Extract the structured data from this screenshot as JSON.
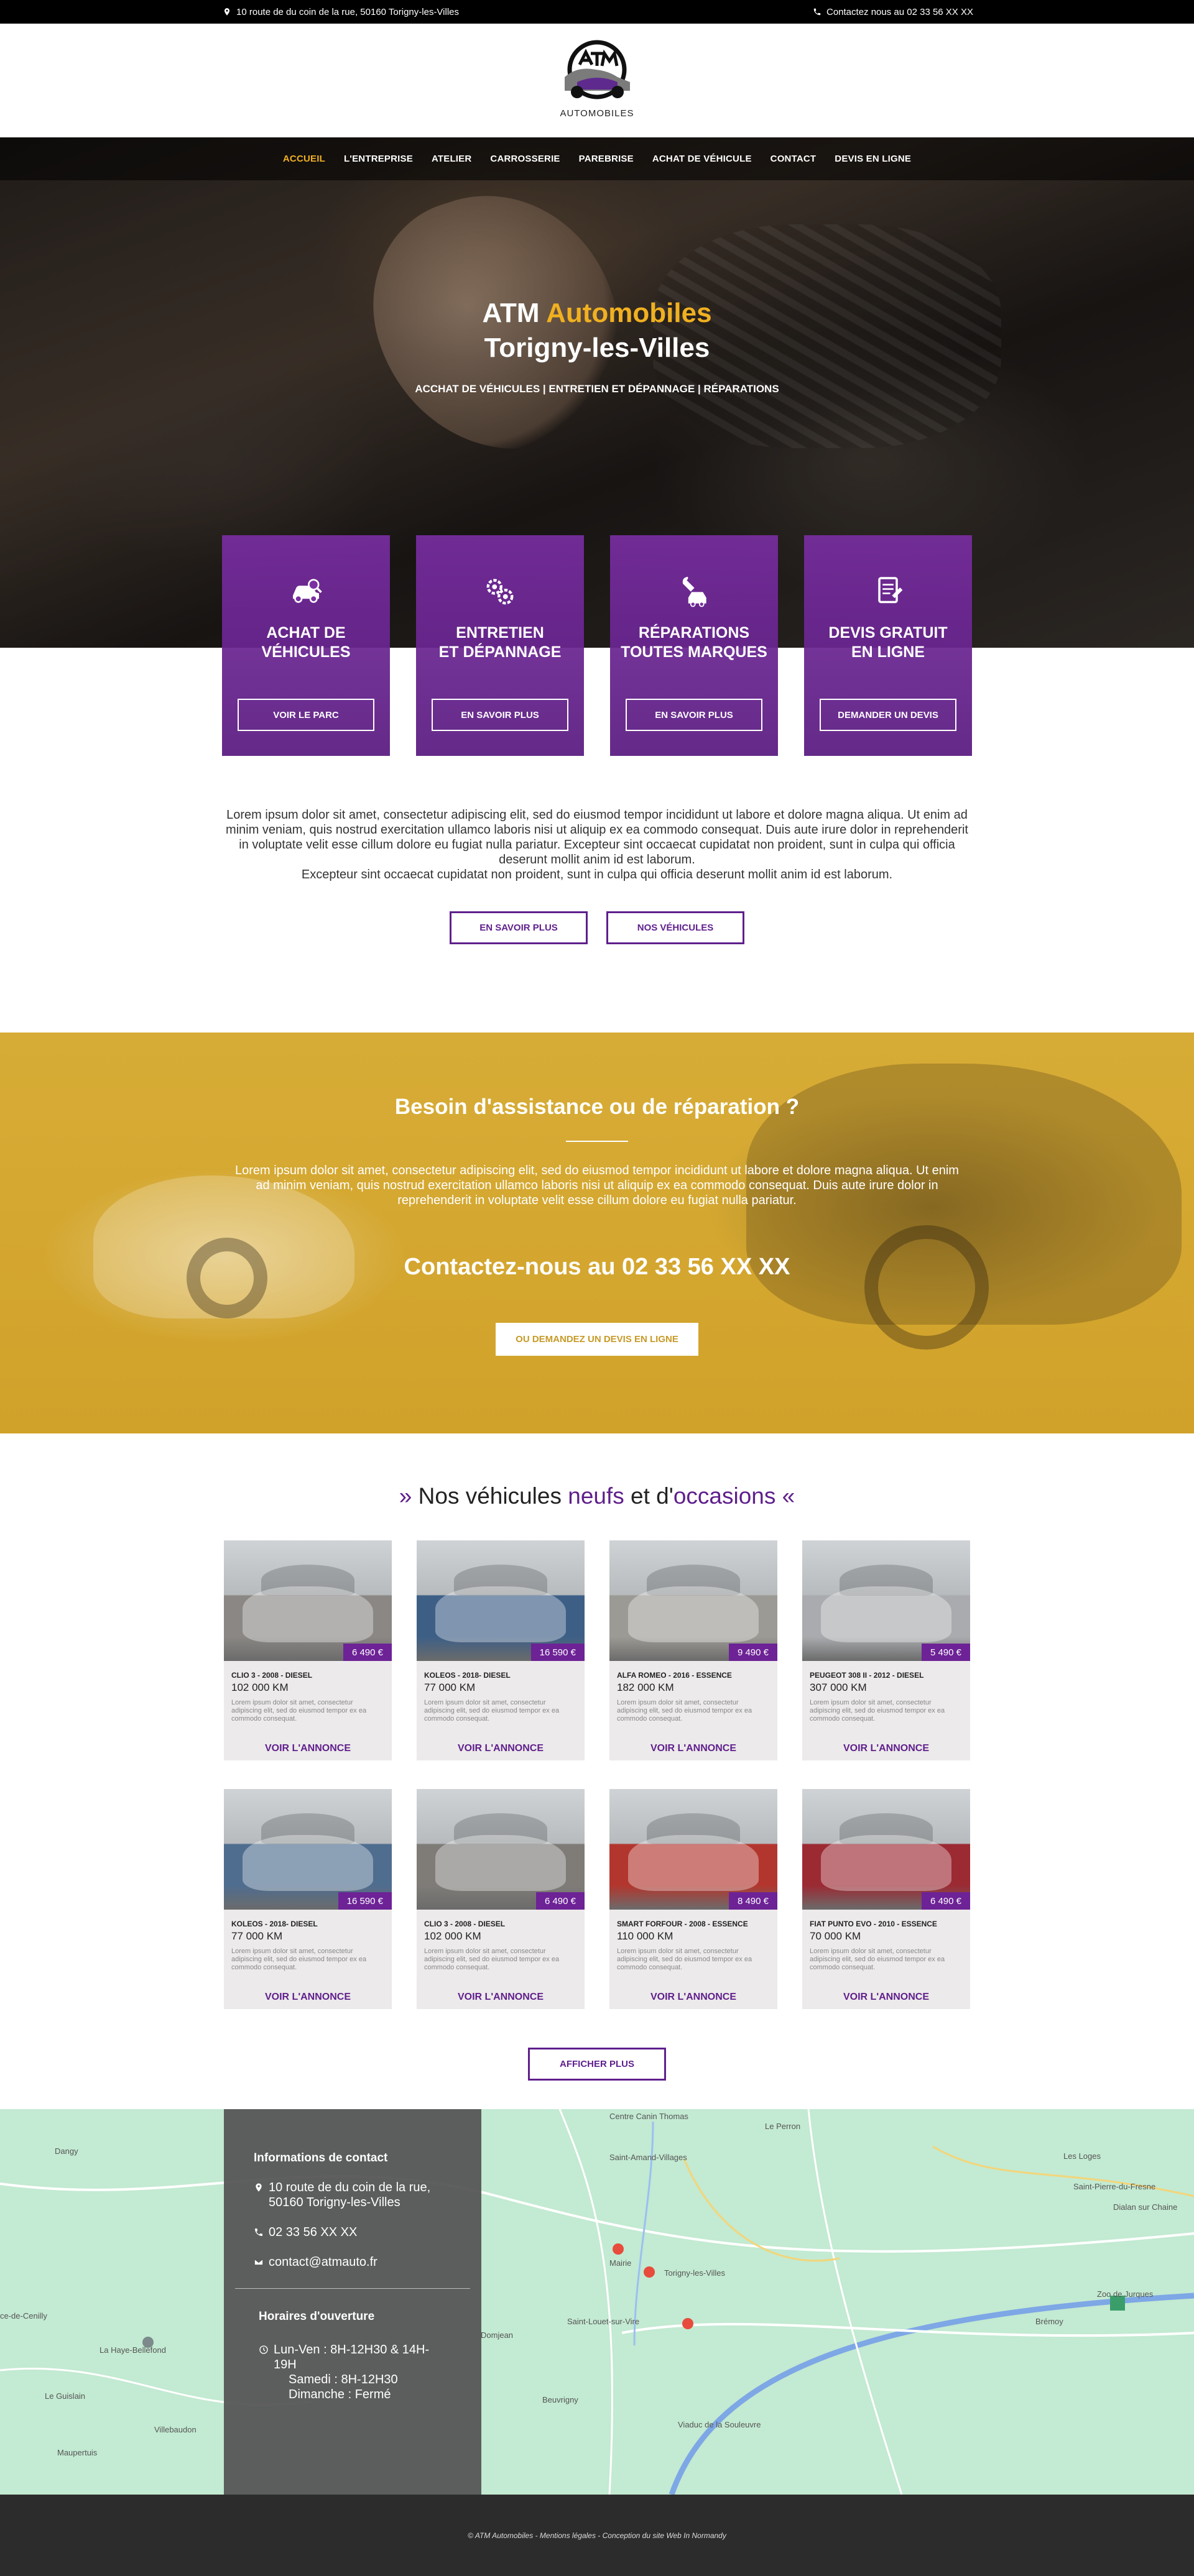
{
  "topbar": {
    "address": "10 route de du coin de la rue, 50160 Torigny-les-Villes",
    "phone": "Contactez nous au 02 33 56 XX XX"
  },
  "logo": {
    "text": "AUTOMOBILES"
  },
  "nav": [
    {
      "label": "ACCUEIL",
      "active": true
    },
    {
      "label": "L'ENTREPRISE"
    },
    {
      "label": "ATELIER"
    },
    {
      "label": "CARROSSERIE"
    },
    {
      "label": "PAREBRISE"
    },
    {
      "label": "ACHAT DE VÉHICULE"
    },
    {
      "label": "CONTACT"
    },
    {
      "label": "DEVIS EN LIGNE"
    }
  ],
  "hero": {
    "title_part1": "ATM ",
    "title_accent": "Automobiles",
    "title_line2": "Torigny-les-Villes",
    "subtitle": "ACCHAT DE VÉHICULES | ENTRETIEN ET DÉPANNAGE | RÉPARATIONS"
  },
  "services": [
    {
      "icon": "car-search-icon",
      "title": "ACHAT DE\nVÉHICULES",
      "button": "VOIR LE PARC"
    },
    {
      "icon": "gears-icon",
      "title": "ENTRETIEN\nET DÉPANNAGE",
      "button": "EN SAVOIR PLUS"
    },
    {
      "icon": "wrench-car-icon",
      "title": "RÉPARATIONS\nTOUTES MARQUES",
      "button": "EN SAVOIR PLUS"
    },
    {
      "icon": "quote-document-icon",
      "title": "DEVIS GRATUIT\nEN LIGNE",
      "button": "DEMANDER UN DEVIS"
    }
  ],
  "intro": {
    "text": "Lorem ipsum dolor sit amet, consectetur adipiscing elit, sed do eiusmod tempor incididunt ut labore et dolore magna aliqua. Ut enim ad minim veniam, quis nostrud exercitation ullamco laboris nisi ut aliquip ex ea commodo consequat. Duis aute irure dolor in reprehenderit in voluptate velit esse cillum dolore eu fugiat nulla pariatur. Excepteur sint occaecat cupidatat non proident, sunt in culpa qui officia deserunt mollit anim id est laborum.",
    "text2": "Excepteur sint occaecat cupidatat non proident, sunt in culpa qui officia deserunt mollit anim id est laborum.",
    "btn1": "EN SAVOIR PLUS",
    "btn2": "NOS VÉHICULES"
  },
  "assist": {
    "title": "Besoin d'assistance ou de réparation ?",
    "text": "Lorem ipsum dolor sit amet, consectetur adipiscing elit, sed do eiusmod tempor incididunt ut labore et dolore magna aliqua. Ut enim ad minim veniam, quis nostrud exercitation ullamco laboris nisi ut aliquip ex ea commodo consequat. Duis aute irure dolor in reprehenderit in voluptate velit esse cillum dolore eu fugiat nulla pariatur.",
    "phone": "Contactez-nous au 02 33 56 XX XX",
    "button": "OU DEMANDEZ UN DEVIS EN LIGNE"
  },
  "vehicles": {
    "heading_prefix": "Nos véhicules ",
    "heading_neufs": "neufs",
    "heading_mid": " et d'",
    "heading_occ": "occasions",
    "quote_open": "»",
    "quote_close": "«",
    "desc": "Lorem ipsum dolor sit amet, consectetur adipiscing elit, sed do eiusmod tempor ex ea commodo consequat.",
    "link": "VOIR L'ANNONCE",
    "more": "AFFICHER PLUS",
    "items": [
      {
        "title": "CLIO 3 - 2008 - DIESEL",
        "km": "102 000 KM",
        "price": "6 490 €",
        "color": "#8a8784"
      },
      {
        "title": "KOLEOS - 2018- DIESEL",
        "km": "77 000 KM",
        "price": "16 590 €",
        "color": "#3d5f86"
      },
      {
        "title": "ALFA ROMEO - 2016 - ESSENCE",
        "km": "182 000 KM",
        "price": "9 490 €",
        "color": "#9c9a94"
      },
      {
        "title": "PEUGEOT 308 II - 2012 - DIESEL",
        "km": "307 000 KM",
        "price": "5 490 €",
        "color": "#a9abae"
      },
      {
        "title": "KOLEOS - 2018- DIESEL",
        "km": "77 000 KM",
        "price": "16 590 €",
        "color": "#4f6d8f"
      },
      {
        "title": "CLIO 3 - 2008 - DIESEL",
        "km": "102 000 KM",
        "price": "6 490 €",
        "color": "#7f7c78"
      },
      {
        "title": "SMART FORFOUR - 2008 - ESSENCE",
        "km": "110 000 KM",
        "price": "8 490 €",
        "color": "#b2362e"
      },
      {
        "title": "FIAT PUNTO EVO - 2010 - ESSENCE",
        "km": "70 000 KM",
        "price": "6 490 €",
        "color": "#9b2a33"
      }
    ]
  },
  "map": {
    "places": [
      "Dangy",
      "Saint-Amand-Villages",
      "Le Perron",
      "Les Loges",
      "Saint-Pierre-du-Fresne",
      "Dialan sur Chaine",
      "Torigny-les-Villes",
      "Mairie",
      "Saint-Louet-sur-Vire",
      "Brémoy",
      "Domjean",
      "Beuvrigny",
      "La Haye-Bellefond",
      "Le Guislain",
      "Maupertuis",
      "Villebaudon",
      "ce-de-Cenilly",
      "Viaduc de la Souleuvre",
      "Centre Canin Thomas",
      "Zoo de Jurques"
    ]
  },
  "contact": {
    "title": "Informations de contact",
    "address": "10 route de du coin de la rue, 50160 Torigny-les-Villes",
    "phone": "02 33 56 XX XX",
    "email": "contact@atmauto.fr",
    "hours_title": "Horaires d'ouverture",
    "hours1": "Lun-Ven : 8H-12H30 & 14H-19H",
    "hours2": "Samedi : 8H-12H30",
    "hours3": "Dimanche : Fermé"
  },
  "footer": {
    "text": "© ATM Automobiles - Mentions légales - Conception du site Web In Normandy"
  },
  "colors": {
    "purple": "#5f1f8c",
    "gold": "#f0b020",
    "assist_bg": "#d4a630"
  }
}
